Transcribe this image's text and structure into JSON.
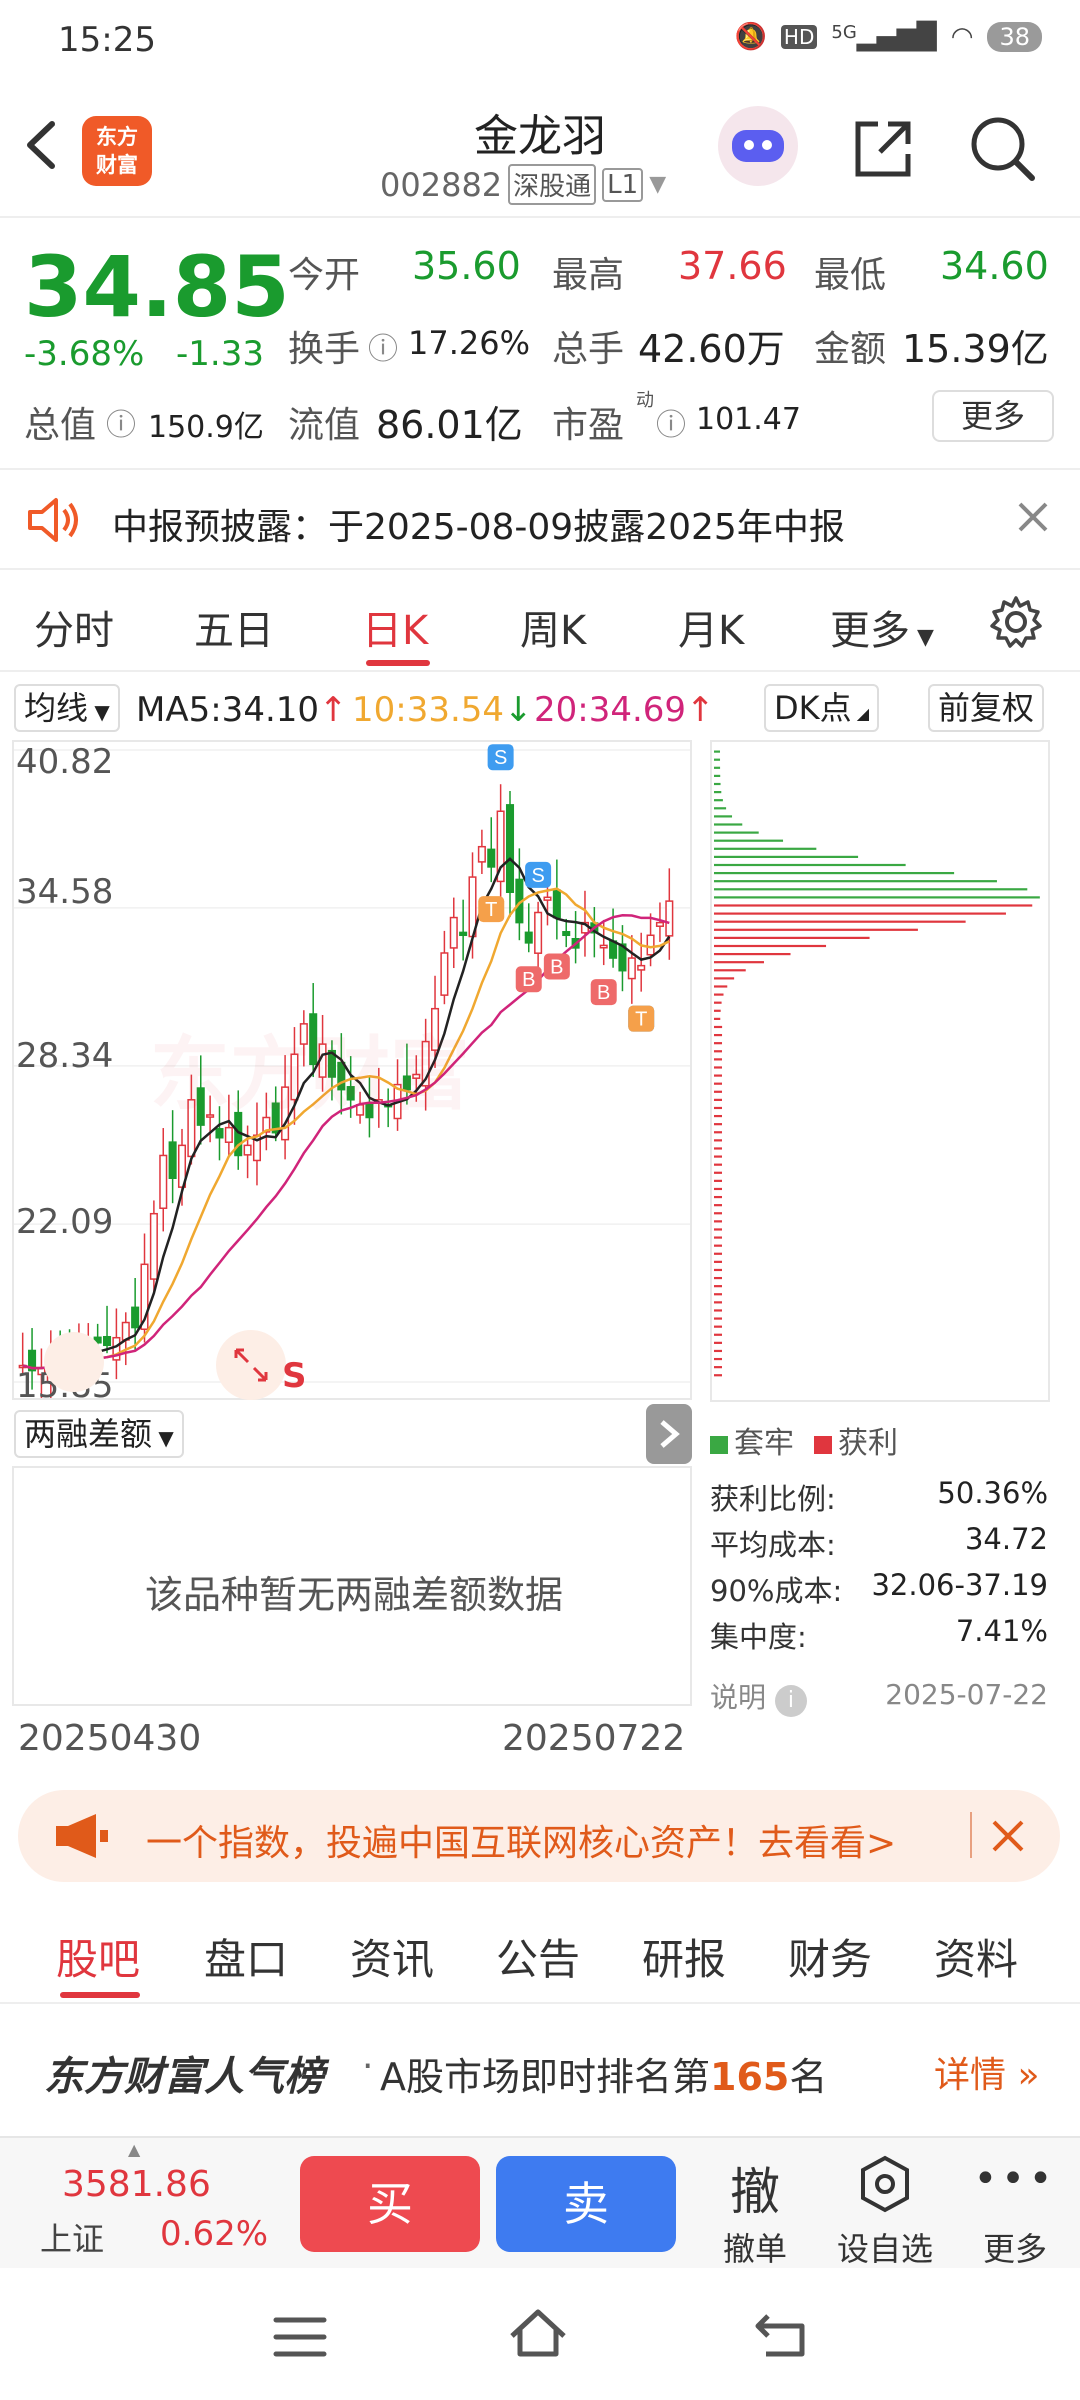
{
  "status_bar": {
    "time": "15:25",
    "network": "5G",
    "hd": "HD",
    "battery": "38"
  },
  "header": {
    "title": "金龙羽",
    "code": "002882",
    "market_tag": "深股通",
    "level_tag": "L1",
    "logo_text_1": "东方",
    "logo_text_2": "财富"
  },
  "quote": {
    "price": "34.85",
    "change_pct": "-3.68%",
    "change_abs": "-1.33",
    "open_label": "今开",
    "open": "35.60",
    "high_label": "最高",
    "high": "37.66",
    "low_label": "最低",
    "low": "34.60",
    "turnover_label": "换手",
    "turnover": "17.26%",
    "volume_label": "总手",
    "volume": "42.60万",
    "amount_label": "金额",
    "amount": "15.39亿",
    "mktcap_label": "总值",
    "mktcap": "150.9亿",
    "float_label": "流值",
    "float_cap": "86.01亿",
    "pe_label": "市盈",
    "pe_sup": "动",
    "pe": "101.47",
    "more": "更多"
  },
  "notice": {
    "text": "中报预披露：于2025-08-09披露2025年中报"
  },
  "period_tabs": [
    "分时",
    "五日",
    "日K",
    "周K",
    "月K",
    "更多"
  ],
  "period_active": "日K",
  "ma_bar": {
    "dropdown": "均线",
    "ma5": "MA5:34.10",
    "ma5_arrow": "↑",
    "ma10": "10:33.54",
    "ma10_arrow": "↓",
    "ma20": "20:34.69",
    "ma20_arrow": "↑",
    "dk": "DK点",
    "adjust": "前复权"
  },
  "chart_data": {
    "type": "candlestick",
    "y_ticks": [
      "40.82",
      "34.58",
      "28.34",
      "22.09",
      "15.85"
    ],
    "ylim": [
      15.85,
      40.82
    ],
    "start_date": "20250430",
    "end_date": "20250722",
    "watermark": "东方财富",
    "signal_s": "S",
    "colors": {
      "up": "#e0363e",
      "down": "#1a9b2e",
      "ma5": "#222222",
      "ma10": "#f0a830",
      "ma20": "#d0247a"
    }
  },
  "margin": {
    "dropdown": "两融差额",
    "empty_text": "该品种暂无两融差额数据"
  },
  "chip": {
    "legend_trapped": "套牢",
    "legend_profit": "获利",
    "stats": [
      {
        "label": "获利比例:",
        "value": "50.36%"
      },
      {
        "label": "平均成本:",
        "value": "34.72"
      },
      {
        "label": "90%成本:",
        "value": "32.06-37.19"
      },
      {
        "label": "集中度:",
        "value": "7.41%"
      }
    ],
    "note_label": "说明",
    "date": "2025-07-22"
  },
  "ad": {
    "text": "一个指数，投遍中国互联网核心资产！去看看>"
  },
  "section_tabs": [
    "股吧",
    "盘口",
    "资讯",
    "公告",
    "研报",
    "财务",
    "资料"
  ],
  "popularity": {
    "brand": "东方财富人气榜",
    "dot": "·",
    "text_prefix": "A股市场即时排名第",
    "rank": "165",
    "text_suffix": "名",
    "link": "详情"
  },
  "tradebar": {
    "index_value": "3581.86",
    "index_name": "上证",
    "index_change": "0.62%",
    "buy": "买",
    "sell": "卖",
    "cancel_icon": "撤",
    "cancel": "撤单",
    "watch": "设自选",
    "more": "更多"
  }
}
